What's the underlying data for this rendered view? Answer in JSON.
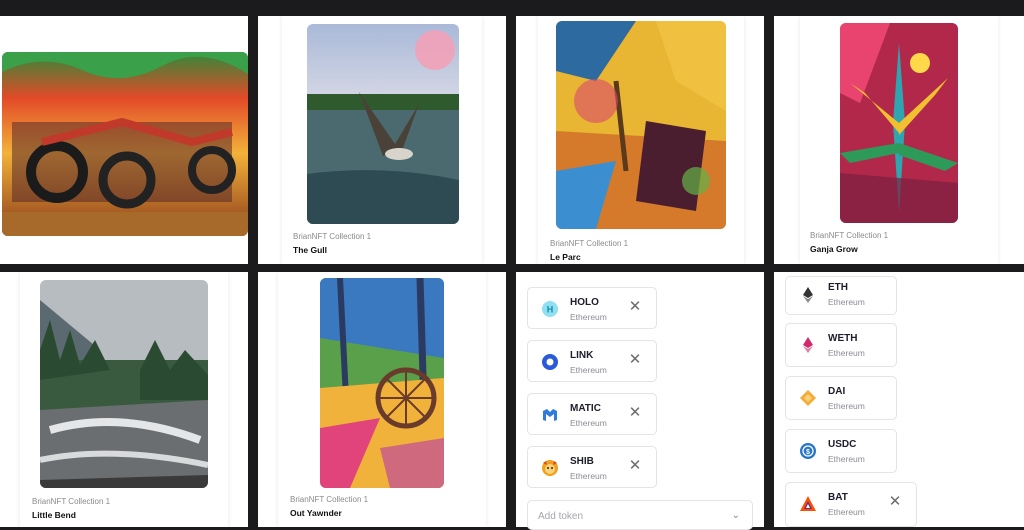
{
  "nfts": [
    {
      "collection": "",
      "title": ""
    },
    {
      "collection": "BrianNFT Collection 1",
      "title": "The Gull"
    },
    {
      "collection": "BrianNFT Collection 1",
      "title": "Le Parc"
    },
    {
      "collection": "BrianNFT Collection 1",
      "title": "Ganja Grow"
    },
    {
      "collection": "BrianNFT Collection 1",
      "title": "Little Bend"
    },
    {
      "collection": "BrianNFT Collection 1",
      "title": "Out Yawnder"
    }
  ],
  "tokens_left": [
    {
      "symbol": "HOLO",
      "network": "Ethereum",
      "icon": "holo-icon",
      "color": "#57c7e6"
    },
    {
      "symbol": "LINK",
      "network": "Ethereum",
      "icon": "link-icon",
      "color": "#2a5ada"
    },
    {
      "symbol": "MATIC",
      "network": "Ethereum",
      "icon": "matic-icon",
      "color": "#2f7bd8"
    },
    {
      "symbol": "SHIB",
      "network": "Ethereum",
      "icon": "shib-icon",
      "color": "#f0a020"
    }
  ],
  "tokens_right": [
    {
      "symbol": "ETH",
      "network": "Ethereum",
      "icon": "eth-icon",
      "color": "#3c3c3d"
    },
    {
      "symbol": "WETH",
      "network": "Ethereum",
      "icon": "weth-icon",
      "color": "#d12a6a"
    },
    {
      "symbol": "DAI",
      "network": "Ethereum",
      "icon": "dai-icon",
      "color": "#f5ac37"
    },
    {
      "symbol": "USDC",
      "network": "Ethereum",
      "icon": "usdc-icon",
      "color": "#2775ca"
    },
    {
      "symbol": "BAT",
      "network": "Ethereum",
      "icon": "bat-icon",
      "color": "#ff5000"
    }
  ],
  "remove_glyph": "✕",
  "add_token": {
    "placeholder": "Add token",
    "chevron": "⌄"
  }
}
